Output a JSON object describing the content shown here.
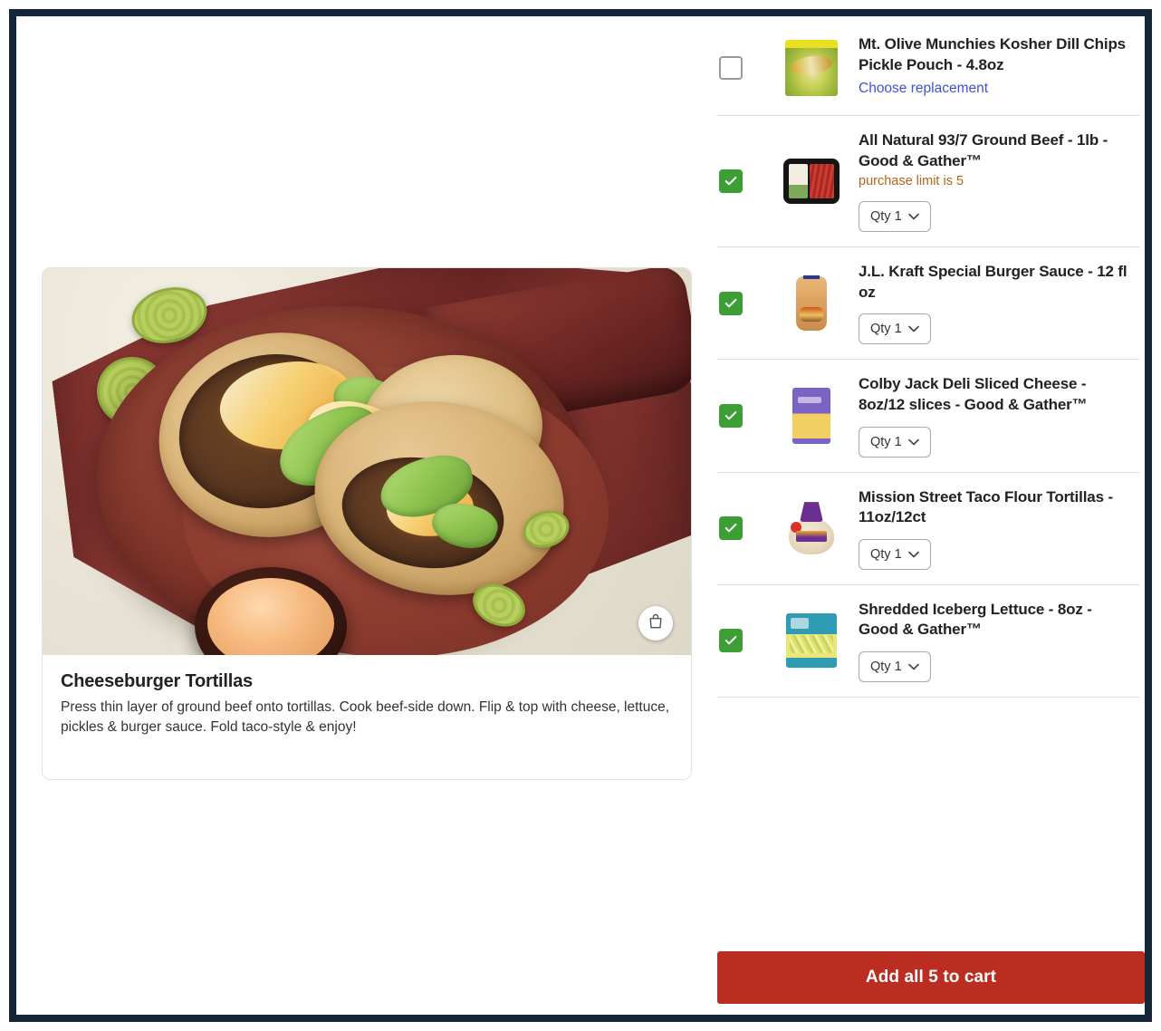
{
  "recipe": {
    "title": "Cheeseburger Tortillas",
    "description": "Press thin layer of ground beef onto tortillas. Cook beef-side down. Flip & top with cheese, lettuce, pickles & burger sauce. Fold taco-style & enjoy!",
    "image_badge_icon": "shopping-bag-icon"
  },
  "colors": {
    "frame": "#13263a",
    "checkbox_checked": "#3d9e36",
    "link": "#3f51d6",
    "limit_note": "#b5651d",
    "cta": "#bb2c21"
  },
  "products": [
    {
      "name": "Mt. Olive Munchies Kosher Dill Chips Pickle Pouch - 4.8oz",
      "checked": false,
      "note": "",
      "link": "Choose replacement",
      "qty_label": "Qty 1",
      "thumb": "pickle-pouch-thumbnail"
    },
    {
      "name": "All Natural 93/7 Ground Beef - 1lb - Good & Gather™",
      "checked": true,
      "note": "purchase limit is 5",
      "link": "",
      "qty_label": "Qty 1",
      "thumb": "ground-beef-thumbnail"
    },
    {
      "name": "J.L. Kraft Special Burger Sauce - 12 fl oz",
      "checked": true,
      "note": "",
      "link": "",
      "qty_label": "Qty 1",
      "thumb": "burger-sauce-thumbnail"
    },
    {
      "name": "Colby Jack Deli Sliced Cheese - 8oz/12 slices - Good & Gather™",
      "checked": true,
      "note": "",
      "link": "",
      "qty_label": "Qty 1",
      "thumb": "sliced-cheese-thumbnail"
    },
    {
      "name": "Mission Street Taco Flour Tortillas - 11oz/12ct",
      "checked": true,
      "note": "",
      "link": "",
      "qty_label": "Qty 1",
      "thumb": "flour-tortillas-thumbnail"
    },
    {
      "name": "Shredded Iceberg Lettuce - 8oz - Good & Gather™",
      "checked": true,
      "note": "",
      "link": "",
      "qty_label": "Qty 1",
      "thumb": "shredded-lettuce-thumbnail"
    }
  ],
  "cta": {
    "add_all_label": "Add all 5 to cart"
  }
}
